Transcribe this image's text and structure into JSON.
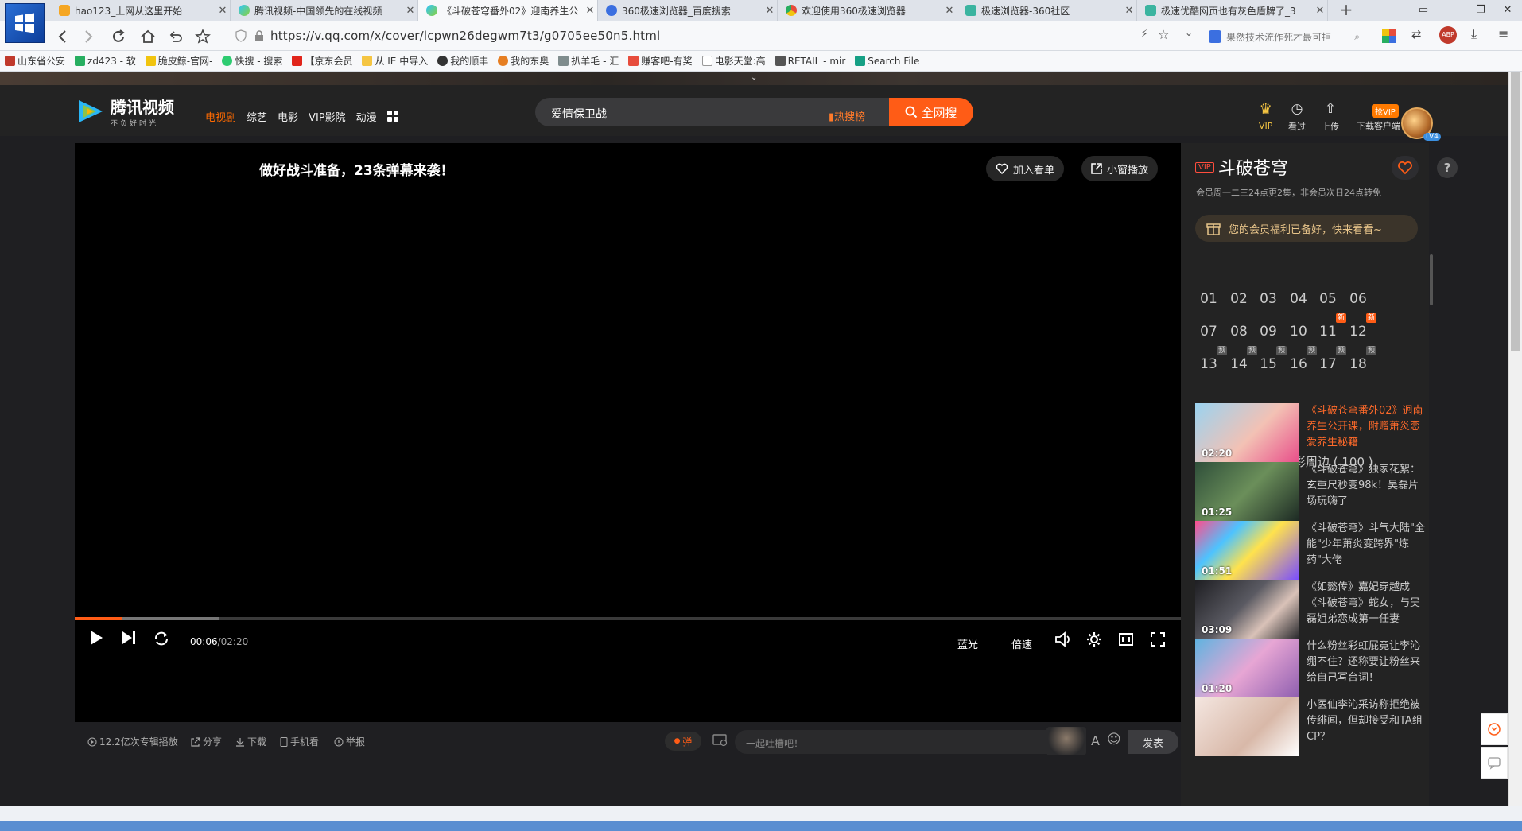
{
  "browser": {
    "tabs": [
      {
        "title": "hao123_上网从这里开始",
        "active": false,
        "icon": "hao123-icon"
      },
      {
        "title": "腾讯视频-中国领先的在线视频",
        "active": false,
        "icon": "tencent-video-icon"
      },
      {
        "title": "《斗破苍穹番外02》迎南养生公",
        "active": true,
        "icon": "tencent-video-icon"
      },
      {
        "title": "360极速浏览器_百度搜索",
        "active": false,
        "icon": "baidu-icon"
      },
      {
        "title": "欢迎使用360极速浏览器",
        "active": false,
        "icon": "chrome-icon"
      },
      {
        "title": "极速浏览器-360社区",
        "active": false,
        "icon": "community-icon"
      },
      {
        "title": "极速优酷网页也有灰色盾牌了_3",
        "active": false,
        "icon": "community-icon"
      }
    ],
    "url": "https://v.qq.com/x/cover/lcpwn26degwm7t3/g0705ee50n5.html",
    "search_hint": "果然技术流作死才最可拒",
    "bookmarks": [
      "山东省公安",
      "zd423 - 软",
      "脆皮鲸-官网-",
      "快搜 - 搜索",
      "【京东会员",
      "从 IE 中导入",
      "我的顺丰",
      "我的东奥",
      "扒羊毛 - 汇",
      "赚客吧-有奖",
      "电影天堂:高",
      "RETAIL - mir",
      "Search File"
    ],
    "accent": "#2a6fd6"
  },
  "site": {
    "logo_text": "腾讯视频",
    "logo_slogan": "不负好时光",
    "nav": [
      "电视剧",
      "综艺",
      "电影",
      "VIP影院",
      "动漫"
    ],
    "search_value": "爱情保卫战",
    "hot_search": "热搜榜",
    "all_web_search": "全网搜",
    "user": {
      "vip": "VIP",
      "history": "看过",
      "upload": "上传",
      "download_client": "下载客户端",
      "grab_vip": "抢VIP",
      "level": "LV4"
    },
    "accent": "#ff5c16"
  },
  "player": {
    "danmu_tip": "做好战斗准备，23条弹幕来袭！",
    "add_watchlist": "加入看单",
    "mini_window": "小窗播放",
    "current_time": "00:06",
    "duration": "/02:20",
    "progress_fraction": 0.043,
    "buffered_fraction": 0.13,
    "quality": "蓝光",
    "speed": "倍速",
    "play_count": "12.2亿次专辑播放",
    "share": "分享",
    "download": "下载",
    "mobile": "手机看",
    "report": "举报",
    "danmu_toggle": "弹",
    "danmu_placeholder": "一起吐槽吧！",
    "send": "发表"
  },
  "sidebar": {
    "vip_tag": "VIP",
    "title": "斗破苍穹",
    "schedule": "会员周一二三24点更2集，非会员次日24点转免",
    "benefit": "您的会员福利已备好，快来看看~",
    "episodes": [
      {
        "num": "01",
        "badge": ""
      },
      {
        "num": "02",
        "badge": ""
      },
      {
        "num": "03",
        "badge": ""
      },
      {
        "num": "04",
        "badge": ""
      },
      {
        "num": "05",
        "badge": ""
      },
      {
        "num": "06",
        "badge": ""
      },
      {
        "num": "07",
        "badge": ""
      },
      {
        "num": "08",
        "badge": ""
      },
      {
        "num": "09",
        "badge": ""
      },
      {
        "num": "10",
        "badge": ""
      },
      {
        "num": "11",
        "badge": "新"
      },
      {
        "num": "12",
        "badge": "新"
      },
      {
        "num": "13",
        "badge": "预"
      },
      {
        "num": "14",
        "badge": "预"
      },
      {
        "num": "15",
        "badge": "预"
      },
      {
        "num": "16",
        "badge": "预"
      },
      {
        "num": "17",
        "badge": "预"
      },
      {
        "num": "18",
        "badge": "预"
      }
    ],
    "related_title": "《斗破苍穹》的精彩周边 ( 100 )",
    "related": [
      {
        "title": "《斗破苍穹番外02》迥南养生公开课，附赠萧炎恋爱养生秘籍",
        "duration": "02:20",
        "current": true
      },
      {
        "title": "《斗破苍穹》独家花絮：玄重尺秒变98k！吴磊片场玩嗨了",
        "duration": "01:25",
        "current": false
      },
      {
        "title": "《斗破苍穹》斗气大陆\"全能\"少年萧炎变跨界\"炼药\"大佬",
        "duration": "01:51",
        "current": false
      },
      {
        "title": "《如懿传》嘉妃穿越成《斗破苍穹》蛇女，与吴磊姐弟恋成第一任妻",
        "duration": "03:09",
        "current": false
      },
      {
        "title": "什么粉丝彩虹屁竟让李沁绷不住？还称要让粉丝来给自己写台词！",
        "duration": "01:20",
        "current": false
      },
      {
        "title": "小医仙李沁采访称拒绝被传绯闻，但却接受和TA组CP？",
        "duration": "",
        "current": false
      }
    ]
  }
}
